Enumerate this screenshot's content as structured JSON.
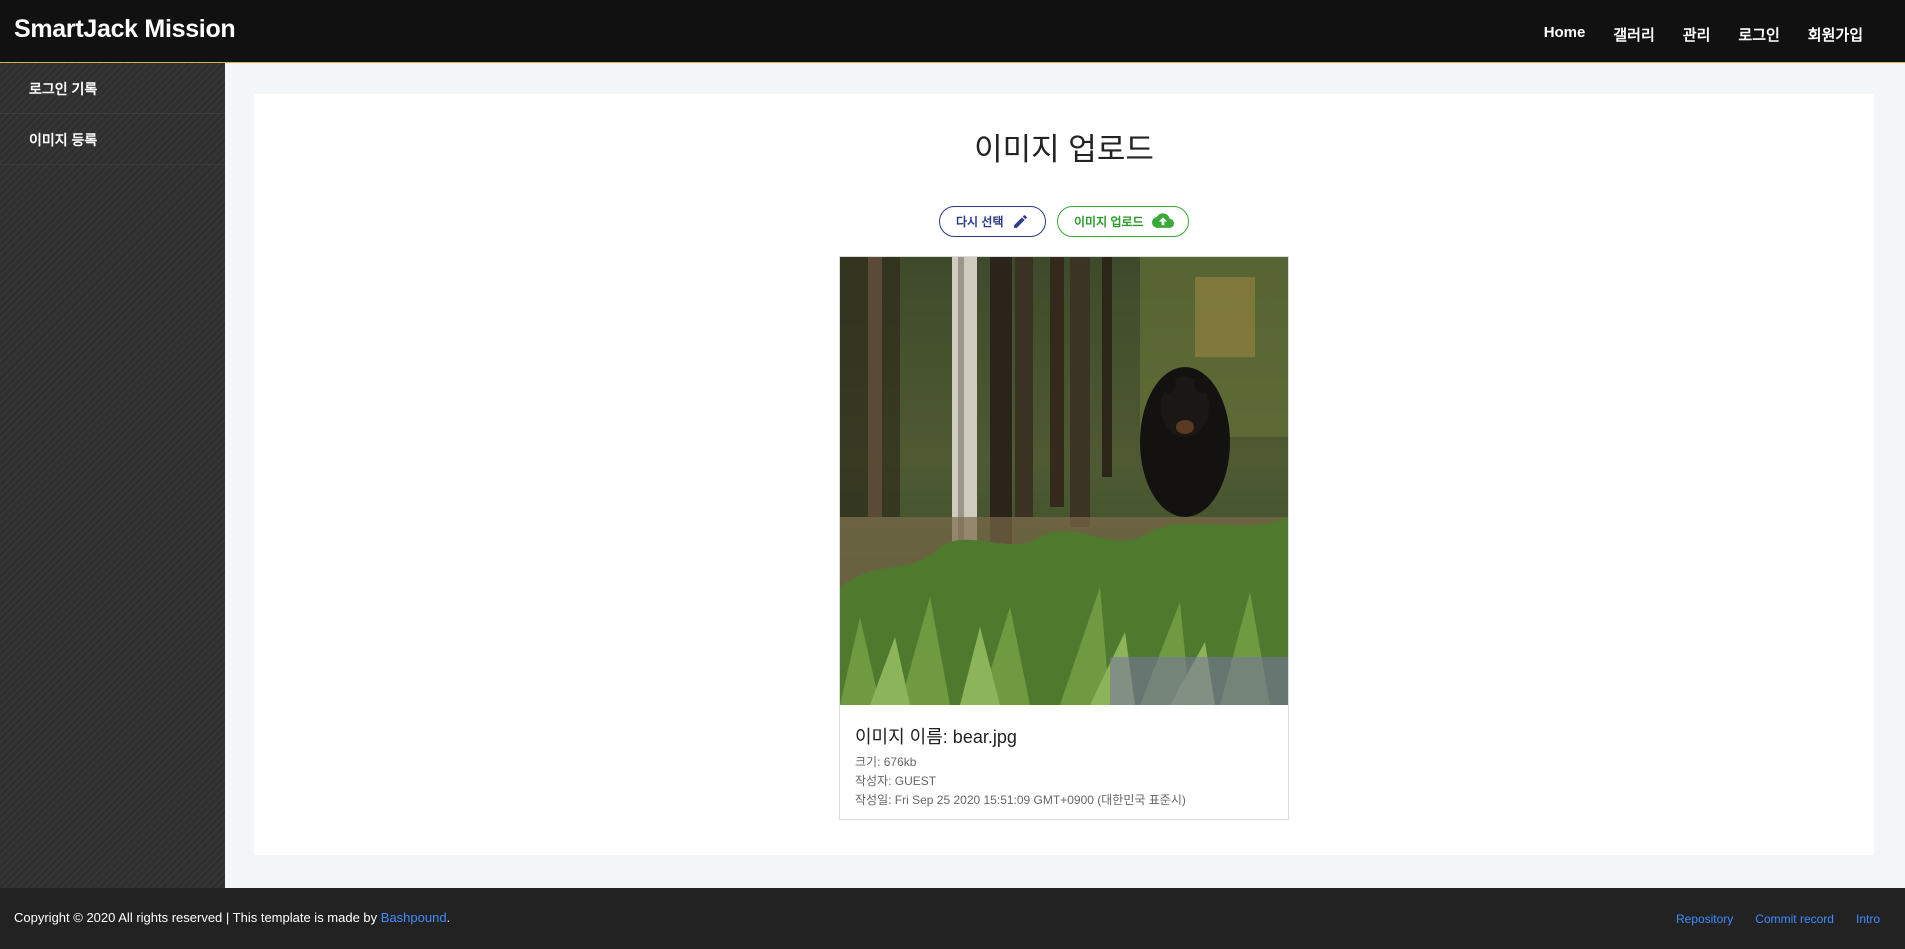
{
  "header": {
    "brand": "SmartJack Mission",
    "nav": [
      "Home",
      "갤러리",
      "관리",
      "로그인",
      "회원가입"
    ]
  },
  "sidebar": {
    "items": [
      {
        "label": "로그인 기록"
      },
      {
        "label": "이미지 등록"
      }
    ]
  },
  "main": {
    "title": "이미지 업로드",
    "buttons": {
      "reselect_label": "다시 선택",
      "reselect_icon": "pencil-icon",
      "upload_label": "이미지 업로드",
      "upload_icon": "cloud-upload-icon"
    },
    "image_card": {
      "name": "이미지 이름: bear.jpg",
      "size": "크기: 676kb",
      "author": "작성자: GUEST",
      "date": "작성일: Fri Sep 25 2020 15:51:09 GMT+0900 (대한민국 표준시)"
    }
  },
  "footer": {
    "copyright_prefix": "Copyright © 2020 All rights reserved | This template is made by ",
    "copyright_link": "Bashpound",
    "copyright_suffix": ".",
    "links": [
      "Repository",
      "Commit record",
      "Intro"
    ]
  },
  "colors": {
    "header_bg": "#111111",
    "sidebar_bg": "#2f2f2f",
    "reselect": "#2d3a8c",
    "upload": "#3aaa3a",
    "link": "#3f8cff"
  }
}
